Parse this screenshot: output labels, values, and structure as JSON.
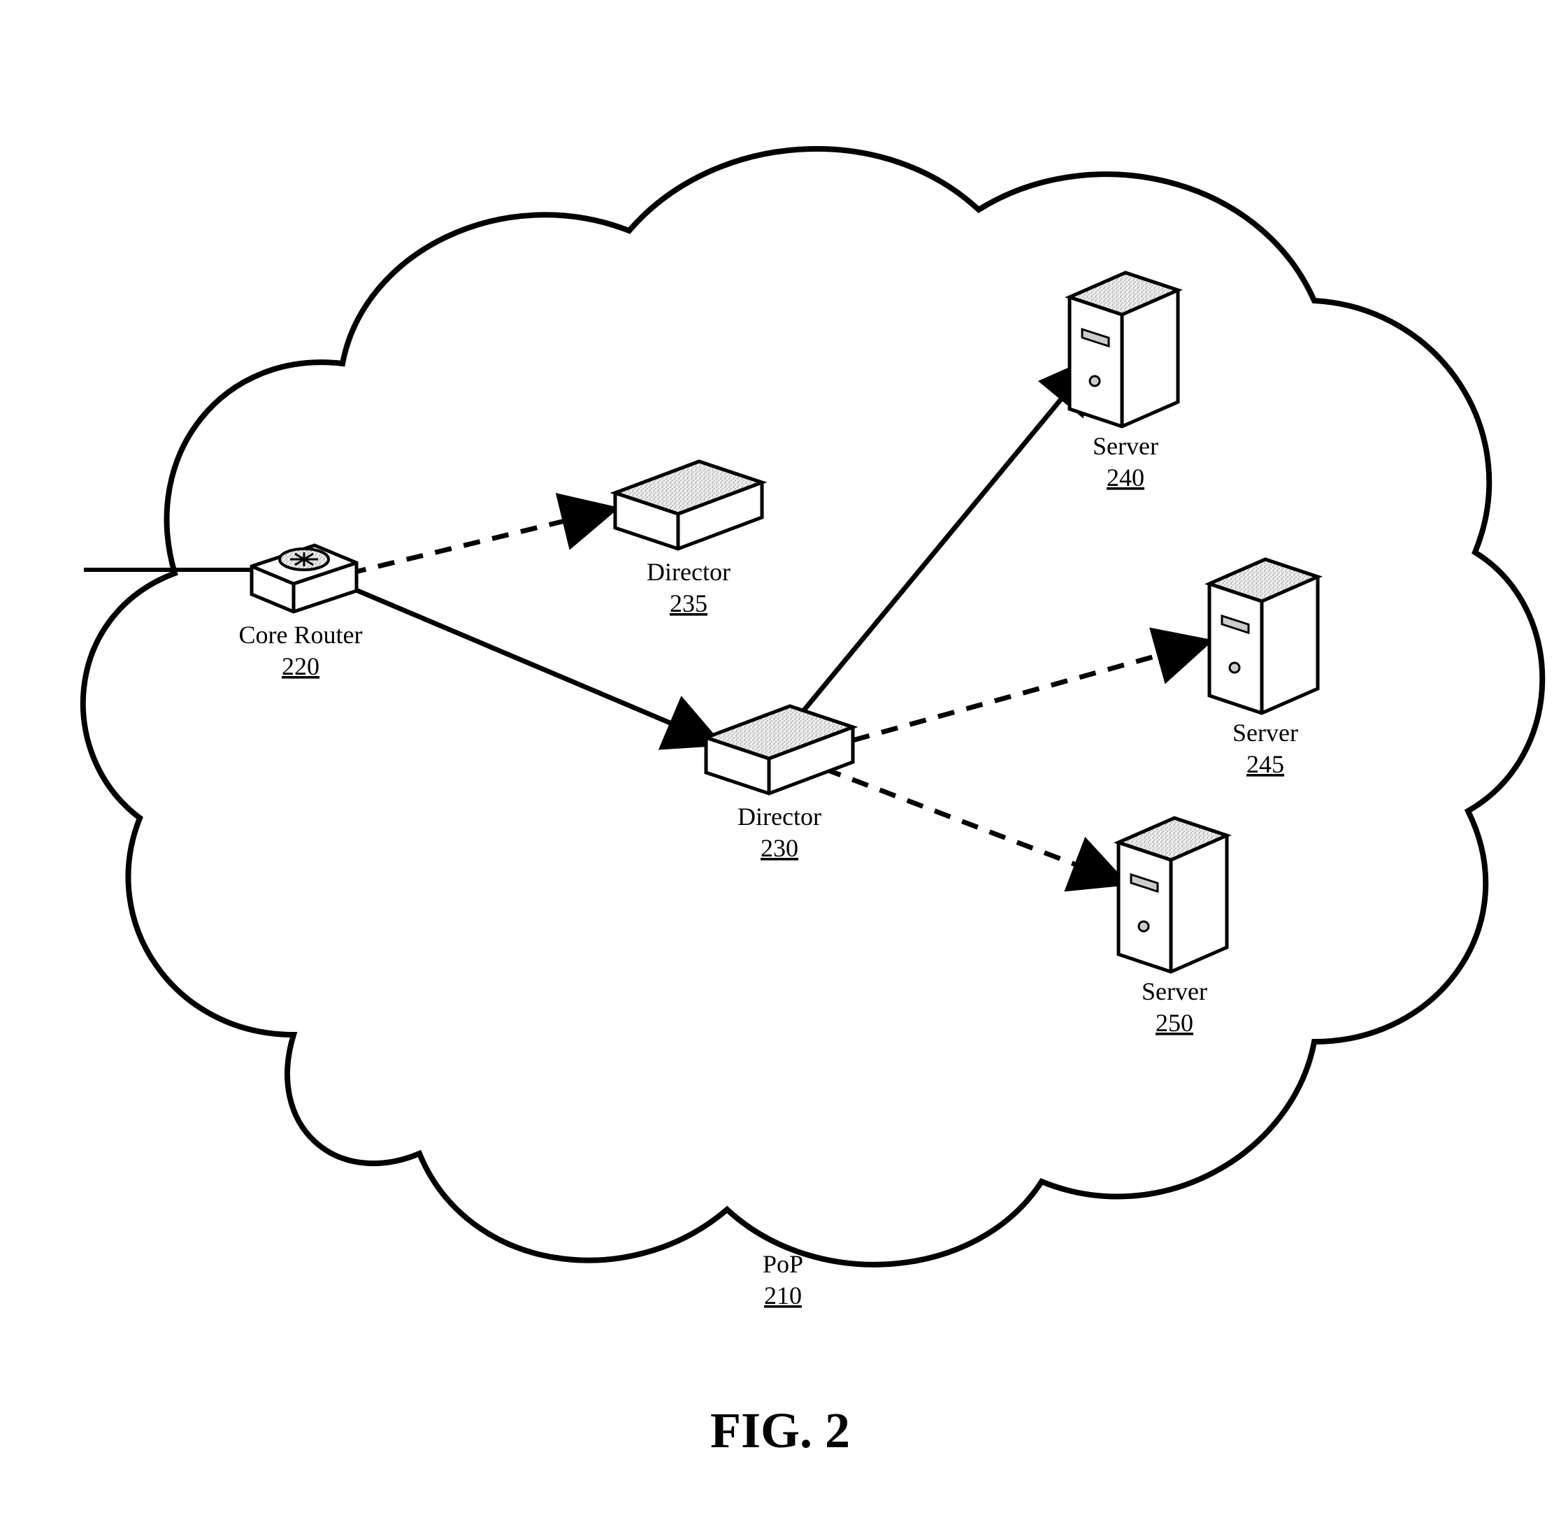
{
  "figure": {
    "caption": "FIG. 2",
    "cloud": {
      "label": "PoP",
      "ref": "210"
    },
    "nodes": {
      "coreRouter": {
        "label": "Core Router",
        "ref": "220"
      },
      "director1": {
        "label": "Director",
        "ref": "235"
      },
      "director2": {
        "label": "Director",
        "ref": "230"
      },
      "server1": {
        "label": "Server",
        "ref": "240"
      },
      "server2": {
        "label": "Server",
        "ref": "245"
      },
      "server3": {
        "label": "Server",
        "ref": "250"
      }
    }
  }
}
